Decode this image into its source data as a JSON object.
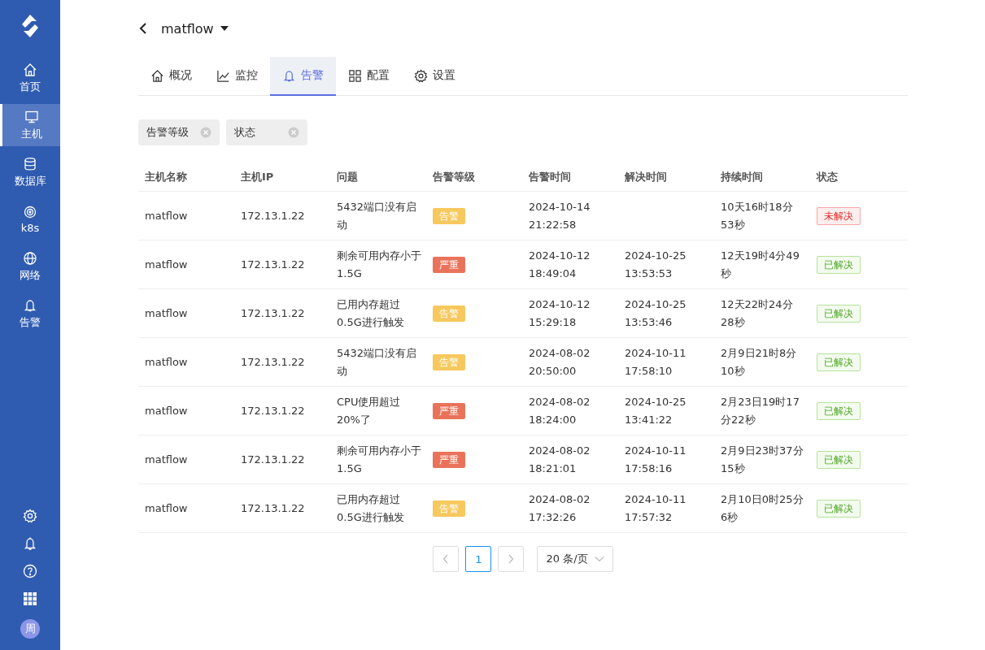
{
  "sidebar": {
    "items": [
      {
        "label": "首页",
        "selected": false
      },
      {
        "label": "主机",
        "selected": true
      },
      {
        "label": "数据库",
        "selected": false
      },
      {
        "label": "k8s",
        "selected": false
      },
      {
        "label": "网络",
        "selected": false
      },
      {
        "label": "告警",
        "selected": false
      }
    ],
    "avatar": "周"
  },
  "header": {
    "title": "matflow"
  },
  "tabs": [
    {
      "label": "概况",
      "selected": false
    },
    {
      "label": "监控",
      "selected": false
    },
    {
      "label": "告警",
      "selected": true
    },
    {
      "label": "配置",
      "selected": false
    },
    {
      "label": "设置",
      "selected": false
    }
  ],
  "filters": [
    {
      "label": "告警等级"
    },
    {
      "label": "状态"
    }
  ],
  "table": {
    "columns": [
      "主机名称",
      "主机IP",
      "问题",
      "告警等级",
      "告警时间",
      "解决时间",
      "持续时间",
      "状态"
    ],
    "rows": [
      {
        "host": "matflow",
        "ip": "172.13.1.22",
        "problem": "5432端口没有启动",
        "level": {
          "kind": "warning",
          "label": "告警"
        },
        "alert_time": "2024-10-14 21:22:58",
        "resolve_time": "",
        "duration": "10天16时18分53秒",
        "status": {
          "resolved": false,
          "label": "未解决"
        }
      },
      {
        "host": "matflow",
        "ip": "172.13.1.22",
        "problem": "剩余可用内存小于1.5G",
        "level": {
          "kind": "critical",
          "label": "严重"
        },
        "alert_time": "2024-10-12 18:49:04",
        "resolve_time": "2024-10-25 13:53:53",
        "duration": "12天19时4分49秒",
        "status": {
          "resolved": true,
          "label": "已解决"
        }
      },
      {
        "host": "matflow",
        "ip": "172.13.1.22",
        "problem": "已用内存超过0.5G进行触发",
        "level": {
          "kind": "warning",
          "label": "告警"
        },
        "alert_time": "2024-10-12 15:29:18",
        "resolve_time": "2024-10-25 13:53:46",
        "duration": "12天22时24分28秒",
        "status": {
          "resolved": true,
          "label": "已解决"
        }
      },
      {
        "host": "matflow",
        "ip": "172.13.1.22",
        "problem": "5432端口没有启动",
        "level": {
          "kind": "warning",
          "label": "告警"
        },
        "alert_time": "2024-08-02 20:50:00",
        "resolve_time": "2024-10-11 17:58:10",
        "duration": "2月9日21时8分10秒",
        "status": {
          "resolved": true,
          "label": "已解决"
        }
      },
      {
        "host": "matflow",
        "ip": "172.13.1.22",
        "problem": "CPU使用超过20%了",
        "level": {
          "kind": "critical",
          "label": "严重"
        },
        "alert_time": "2024-08-02 18:24:00",
        "resolve_time": "2024-10-25 13:41:22",
        "duration": "2月23日19时17分22秒",
        "status": {
          "resolved": true,
          "label": "已解决"
        }
      },
      {
        "host": "matflow",
        "ip": "172.13.1.22",
        "problem": "剩余可用内存小于1.5G",
        "level": {
          "kind": "critical",
          "label": "严重"
        },
        "alert_time": "2024-08-02 18:21:01",
        "resolve_time": "2024-10-11 17:58:16",
        "duration": "2月9日23时37分15秒",
        "status": {
          "resolved": true,
          "label": "已解决"
        }
      },
      {
        "host": "matflow",
        "ip": "172.13.1.22",
        "problem": "已用内存超过0.5G进行触发",
        "level": {
          "kind": "warning",
          "label": "告警"
        },
        "alert_time": "2024-08-02 17:32:26",
        "resolve_time": "2024-10-11 17:57:32",
        "duration": "2月10日0时25分6秒",
        "status": {
          "resolved": true,
          "label": "已解决"
        }
      }
    ]
  },
  "pagination": {
    "pages": [
      {
        "label": "1",
        "selected": true
      }
    ],
    "page_size": "20 条/页"
  }
}
